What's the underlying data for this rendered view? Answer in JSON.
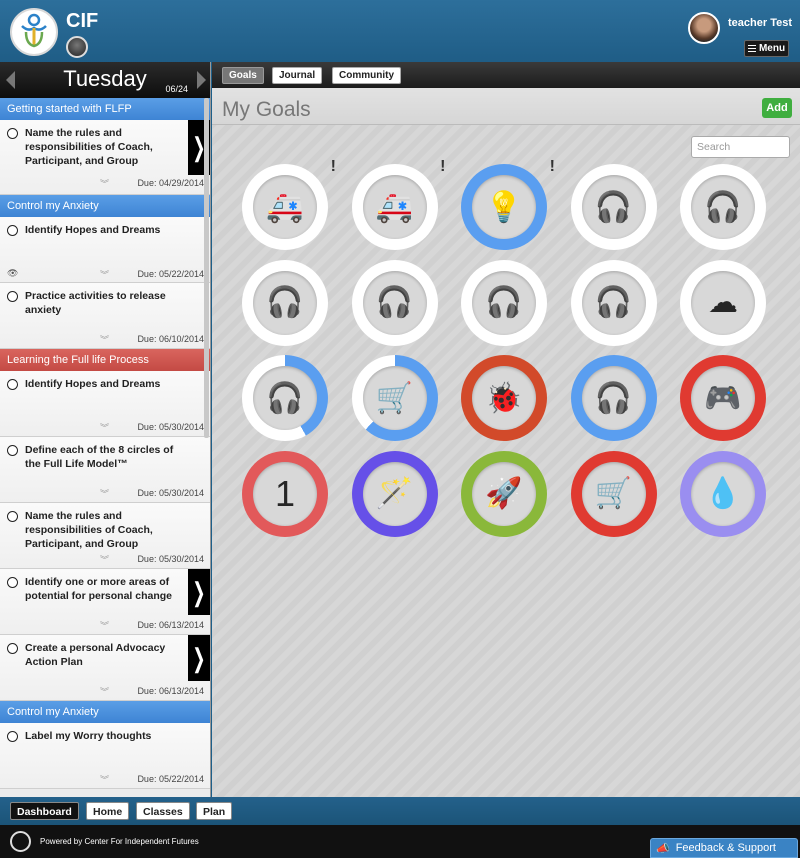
{
  "header": {
    "app_name": "CIF",
    "user_name": "teacher Test",
    "menu_label": "Menu"
  },
  "day_nav": {
    "day": "Tuesday",
    "date": "06/24"
  },
  "tasks": {
    "cat1": "Getting started with FLFP",
    "t1": {
      "title": "Name the rules and responsibilities of Coach, Participant, and Group",
      "due": "Due: 04/29/2014"
    },
    "cat2": "Control my Anxiety",
    "t2": {
      "title": "Identify Hopes and Dreams",
      "due": "Due: 05/22/2014"
    },
    "t3": {
      "title": "Practice activities to release anxiety",
      "due": "Due: 06/10/2014"
    },
    "cat3": "Learning the Full life Process",
    "t4": {
      "title": "Identify Hopes and Dreams",
      "due": "Due: 05/30/2014"
    },
    "t5": {
      "title": "Define each of the 8 circles of the Full Life Model™",
      "due": "Due: 05/30/2014"
    },
    "t6": {
      "title": "Name the rules and responsibilities of Coach, Participant, and Group",
      "due": "Due: 05/30/2014"
    },
    "t7": {
      "title": "Identify one or more areas of potential for personal change",
      "due": "Due: 06/13/2014"
    },
    "t8": {
      "title": "Create a personal Advocacy Action Plan",
      "due": "Due: 06/13/2014"
    },
    "cat4": "Control my Anxiety",
    "t9": {
      "title": "Label my Worry thoughts",
      "due": "Due: 05/22/2014"
    }
  },
  "tabs": {
    "goals": "Goals",
    "journal": "Journal",
    "community": "Community"
  },
  "main": {
    "title": "My Goals",
    "add_label": "Add",
    "search_placeholder": "Search"
  },
  "goals": [
    {
      "icon": "ambulance-icon",
      "glyph": "🚑",
      "ring_color": "#ffffff",
      "progress": 0,
      "alert": "!"
    },
    {
      "icon": "ambulance-icon",
      "glyph": "🚑",
      "ring_color": "#ffffff",
      "progress": 0,
      "alert": "!"
    },
    {
      "icon": "lightbulb-icon",
      "glyph": "💡",
      "ring_color": "#5a9ef0",
      "progress": 1,
      "alert": "!"
    },
    {
      "icon": "headphones-icon",
      "glyph": "🎧",
      "ring_color": "#ffffff",
      "progress": 0,
      "alert": ""
    },
    {
      "icon": "headphones-icon",
      "glyph": "🎧",
      "ring_color": "#ffffff",
      "progress": 0,
      "alert": ""
    },
    {
      "icon": "headphones-icon",
      "glyph": "🎧",
      "ring_color": "#ffffff",
      "progress": 0,
      "alert": ""
    },
    {
      "icon": "headphones-icon",
      "glyph": "🎧",
      "ring_color": "#ffffff",
      "progress": 0,
      "alert": ""
    },
    {
      "icon": "headphones-icon",
      "glyph": "🎧",
      "ring_color": "#ffffff",
      "progress": 0,
      "alert": ""
    },
    {
      "icon": "headphones-icon",
      "glyph": "🎧",
      "ring_color": "#ffffff",
      "progress": 0,
      "alert": ""
    },
    {
      "icon": "cloud-icon",
      "glyph": "☁",
      "ring_color": "#ffffff",
      "progress": 0,
      "alert": ""
    },
    {
      "icon": "headphones-icon",
      "glyph": "🎧",
      "ring_color": "#5a9ef0",
      "progress": 0.42,
      "alert": ""
    },
    {
      "icon": "shopping-cart-icon",
      "glyph": "🛒",
      "ring_color": "#5a9ef0",
      "progress": 0.62,
      "alert": ""
    },
    {
      "icon": "bug-icon",
      "glyph": "🐞",
      "ring_color": "#d24a2a",
      "progress": 1,
      "alert": ""
    },
    {
      "icon": "headphones-icon",
      "glyph": "🎧",
      "ring_color": "#5a9ef0",
      "progress": 1,
      "alert": ""
    },
    {
      "icon": "gamepad-icon",
      "glyph": "🎮",
      "ring_color": "#e03a31",
      "progress": 1,
      "alert": ""
    },
    {
      "icon": "number-one-icon",
      "glyph": "1",
      "ring_color": "#e2595a",
      "progress": 1,
      "alert": ""
    },
    {
      "icon": "magic-wand-icon",
      "glyph": "🪄",
      "ring_color": "#6650e8",
      "progress": 1,
      "alert": ""
    },
    {
      "icon": "rocket-icon",
      "glyph": "🚀",
      "ring_color": "#8ab83a",
      "progress": 1,
      "alert": ""
    },
    {
      "icon": "shopping-cart-icon",
      "glyph": "🛒",
      "ring_color": "#e03a31",
      "progress": 1,
      "alert": ""
    },
    {
      "icon": "water-drop-icon",
      "glyph": "💧",
      "ring_color": "#9a8ef0",
      "progress": 1,
      "alert": ""
    }
  ],
  "bottom_nav": {
    "dashboard": "Dashboard",
    "home": "Home",
    "classes": "Classes",
    "plan": "Plan"
  },
  "footer": {
    "powered": "Powered by Center For Independent Futures",
    "feedback": "Feedback & Support"
  }
}
